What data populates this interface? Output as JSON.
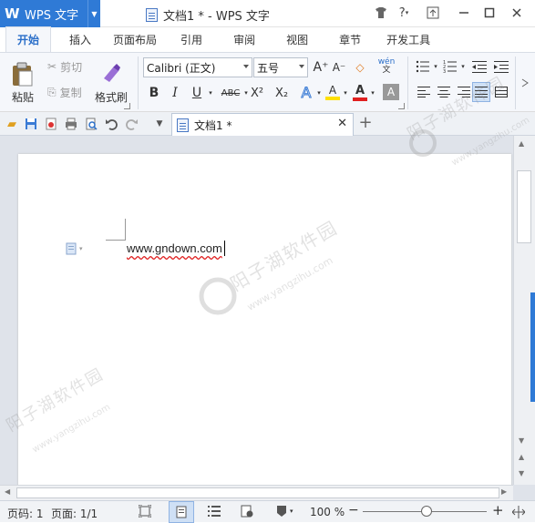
{
  "app": {
    "name": "WPS 文字",
    "title": "文档1 * - WPS 文字"
  },
  "tabs": [
    "开始",
    "插入",
    "页面布局",
    "引用",
    "审阅",
    "视图",
    "章节",
    "开发工具"
  ],
  "ribbon": {
    "paste": "粘贴",
    "cut": "剪切",
    "copy": "复制",
    "format_painter": "格式刷",
    "font_name": "Calibri (正文)",
    "font_size": "五号",
    "bold": "B",
    "italic": "I",
    "underline": "U",
    "strike": "ABC",
    "superscript": "X²",
    "subscript": "X₂",
    "text_effect": "A",
    "highlight": "A",
    "font_color": "A",
    "grow": "A⁺",
    "shrink": "A⁻",
    "phonetic": "wén"
  },
  "doc_tab": {
    "label": "文档1 *"
  },
  "document": {
    "text": "www.gndown.com"
  },
  "status": {
    "page_no": "页码: 1",
    "pages": "页面: 1/1",
    "zoom": "100 %"
  },
  "watermark": {
    "cn": "阳子湖软件园",
    "url": "www.yangzihu.com"
  },
  "colors": {
    "accent": "#2f7ad6",
    "highlight_bar": "#ffe000",
    "font_color_bar": "#e02020"
  }
}
